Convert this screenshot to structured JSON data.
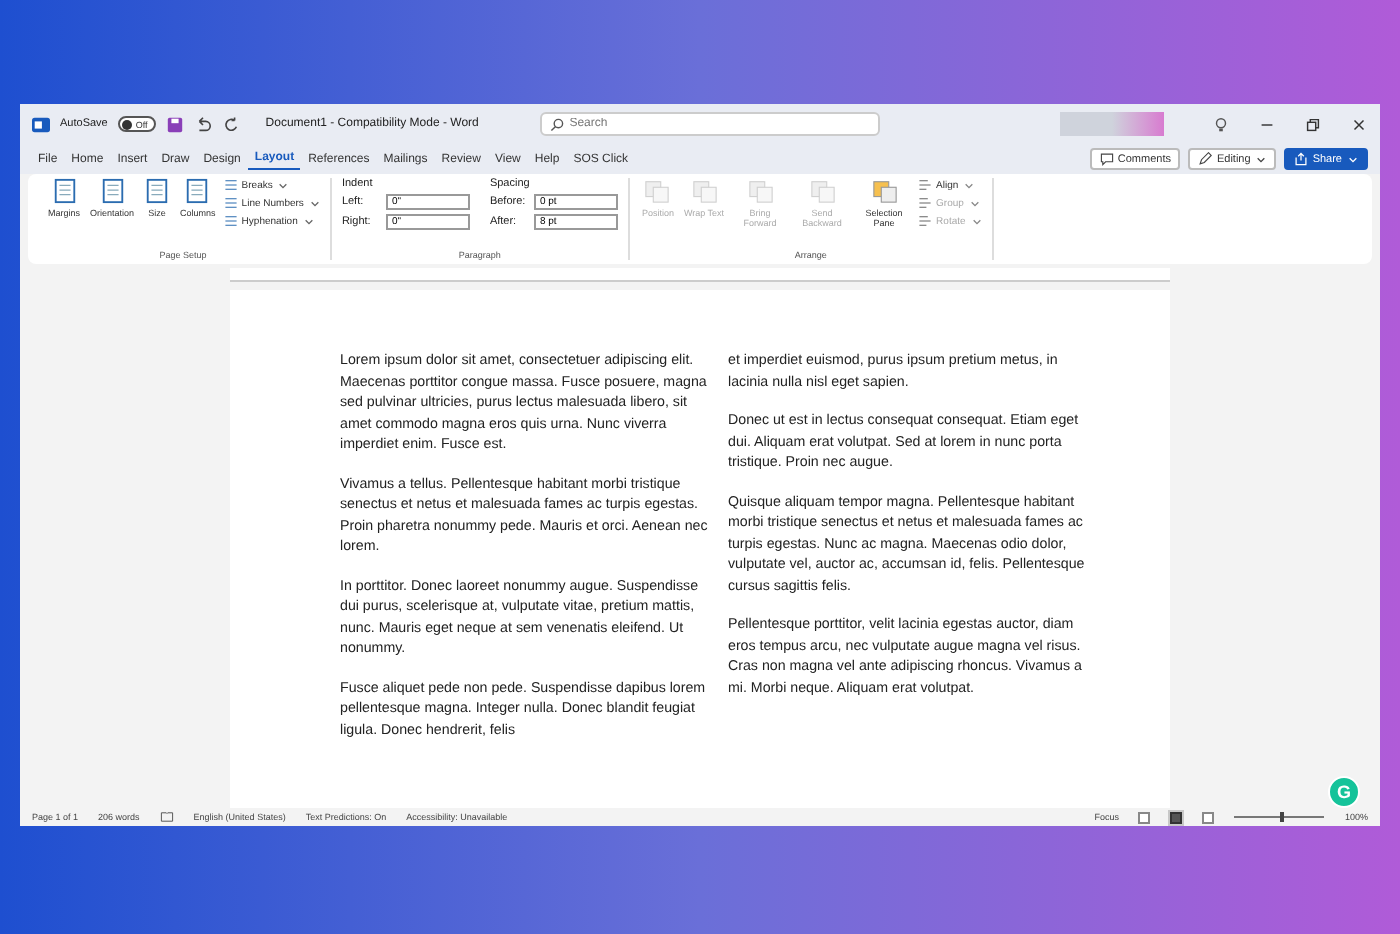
{
  "title_bar": {
    "autosave_label": "AutoSave",
    "autosave_on": false,
    "autosave_state": "Off",
    "document_title": "Document1  -  Compatibility Mode  -  Word",
    "search": {
      "placeholder": "Search"
    }
  },
  "tabs": [
    {
      "label": "File",
      "selected": false
    },
    {
      "label": "Home",
      "selected": false
    },
    {
      "label": "Insert",
      "selected": false
    },
    {
      "label": "Draw",
      "selected": false
    },
    {
      "label": "Design",
      "selected": false
    },
    {
      "label": "Layout",
      "selected": true
    },
    {
      "label": "References",
      "selected": false
    },
    {
      "label": "Mailings",
      "selected": false
    },
    {
      "label": "Review",
      "selected": false
    },
    {
      "label": "View",
      "selected": false
    },
    {
      "label": "Help",
      "selected": false
    },
    {
      "label": "SOS Click",
      "selected": false
    }
  ],
  "tab_actions": {
    "comments": "Comments",
    "editing": "Editing",
    "share": "Share"
  },
  "ribbon": {
    "page_setup": {
      "label": "Page Setup",
      "large_buttons": [
        {
          "label": "Margins",
          "disabled": false
        },
        {
          "label": "Orientation",
          "disabled": false
        },
        {
          "label": "Size",
          "disabled": false
        },
        {
          "label": "Columns",
          "disabled": false
        }
      ],
      "small_buttons": [
        {
          "label": "Breaks",
          "disabled": false
        },
        {
          "label": "Line Numbers",
          "disabled": false
        },
        {
          "label": "Hyphenation",
          "disabled": false
        }
      ]
    },
    "paragraph": {
      "label": "Paragraph",
      "indent_label": "Indent",
      "spacing_label": "Spacing",
      "indent": [
        {
          "label": "Left:",
          "value": "0\""
        },
        {
          "label": "Right:",
          "value": "0\""
        }
      ],
      "spacing": [
        {
          "label": "Before:",
          "value": "0 pt"
        },
        {
          "label": "After:",
          "value": "8 pt"
        }
      ]
    },
    "arrange": {
      "label": "Arrange",
      "large_buttons": [
        {
          "label": "Position",
          "disabled": true
        },
        {
          "label": "Wrap Text",
          "disabled": true
        },
        {
          "label": "Bring Forward",
          "disabled": true
        },
        {
          "label": "Send Backward",
          "disabled": true
        },
        {
          "label": "Selection Pane",
          "disabled": false
        }
      ],
      "small_buttons": [
        {
          "label": "Align",
          "disabled": false
        },
        {
          "label": "Group",
          "disabled": true
        },
        {
          "label": "Rotate",
          "disabled": true
        }
      ]
    }
  },
  "document": {
    "columns": [
      [
        "Lorem ipsum dolor sit amet, consectetuer adipiscing elit. Maecenas porttitor congue massa. Fusce posuere, magna sed pulvinar ultricies, purus lectus malesuada libero, sit amet commodo magna eros quis urna. Nunc viverra imperdiet enim. Fusce est.",
        "Vivamus a tellus. Pellentesque habitant morbi tristique senectus et netus et malesuada fames ac turpis egestas. Proin pharetra nonummy pede. Mauris et orci. Aenean nec lorem.",
        "In porttitor. Donec laoreet nonummy augue. Suspendisse dui purus, scelerisque at, vulputate vitae, pretium mattis, nunc. Mauris eget neque at sem venenatis eleifend. Ut nonummy.",
        "Fusce aliquet pede non pede. Suspendisse dapibus lorem pellentesque magna. Integer nulla. Donec blandit feugiat ligula. Donec hendrerit, felis"
      ],
      [
        "et imperdiet euismod, purus ipsum pretium metus, in lacinia nulla nisl eget sapien.",
        "Donec ut est in lectus consequat consequat. Etiam eget dui. Aliquam erat volutpat. Sed at lorem in nunc porta tristique. Proin nec augue.",
        "Quisque aliquam tempor magna. Pellentesque habitant morbi tristique senectus et netus et malesuada fames ac turpis egestas. Nunc ac magna. Maecenas odio dolor, vulputate vel, auctor ac, accumsan id, felis. Pellentesque cursus sagittis felis.",
        "Pellentesque porttitor, velit lacinia egestas auctor, diam eros tempus arcu, nec vulputate augue magna vel risus. Cras non magna vel ante adipiscing rhoncus. Vivamus a mi. Morbi neque. Aliquam erat volutpat."
      ]
    ]
  },
  "assistant_badge": "G",
  "status_bar": {
    "page": "Page 1 of 1",
    "words": "206 words",
    "language": "English (United States)",
    "predictions": "Text Predictions: On",
    "accessibility": "Accessibility: Unavailable",
    "focus": "Focus",
    "views": [
      {
        "selected": false
      },
      {
        "selected": true
      },
      {
        "selected": false
      }
    ],
    "zoom": {
      "level": 0.5
    },
    "zoom_reading": "100%"
  }
}
